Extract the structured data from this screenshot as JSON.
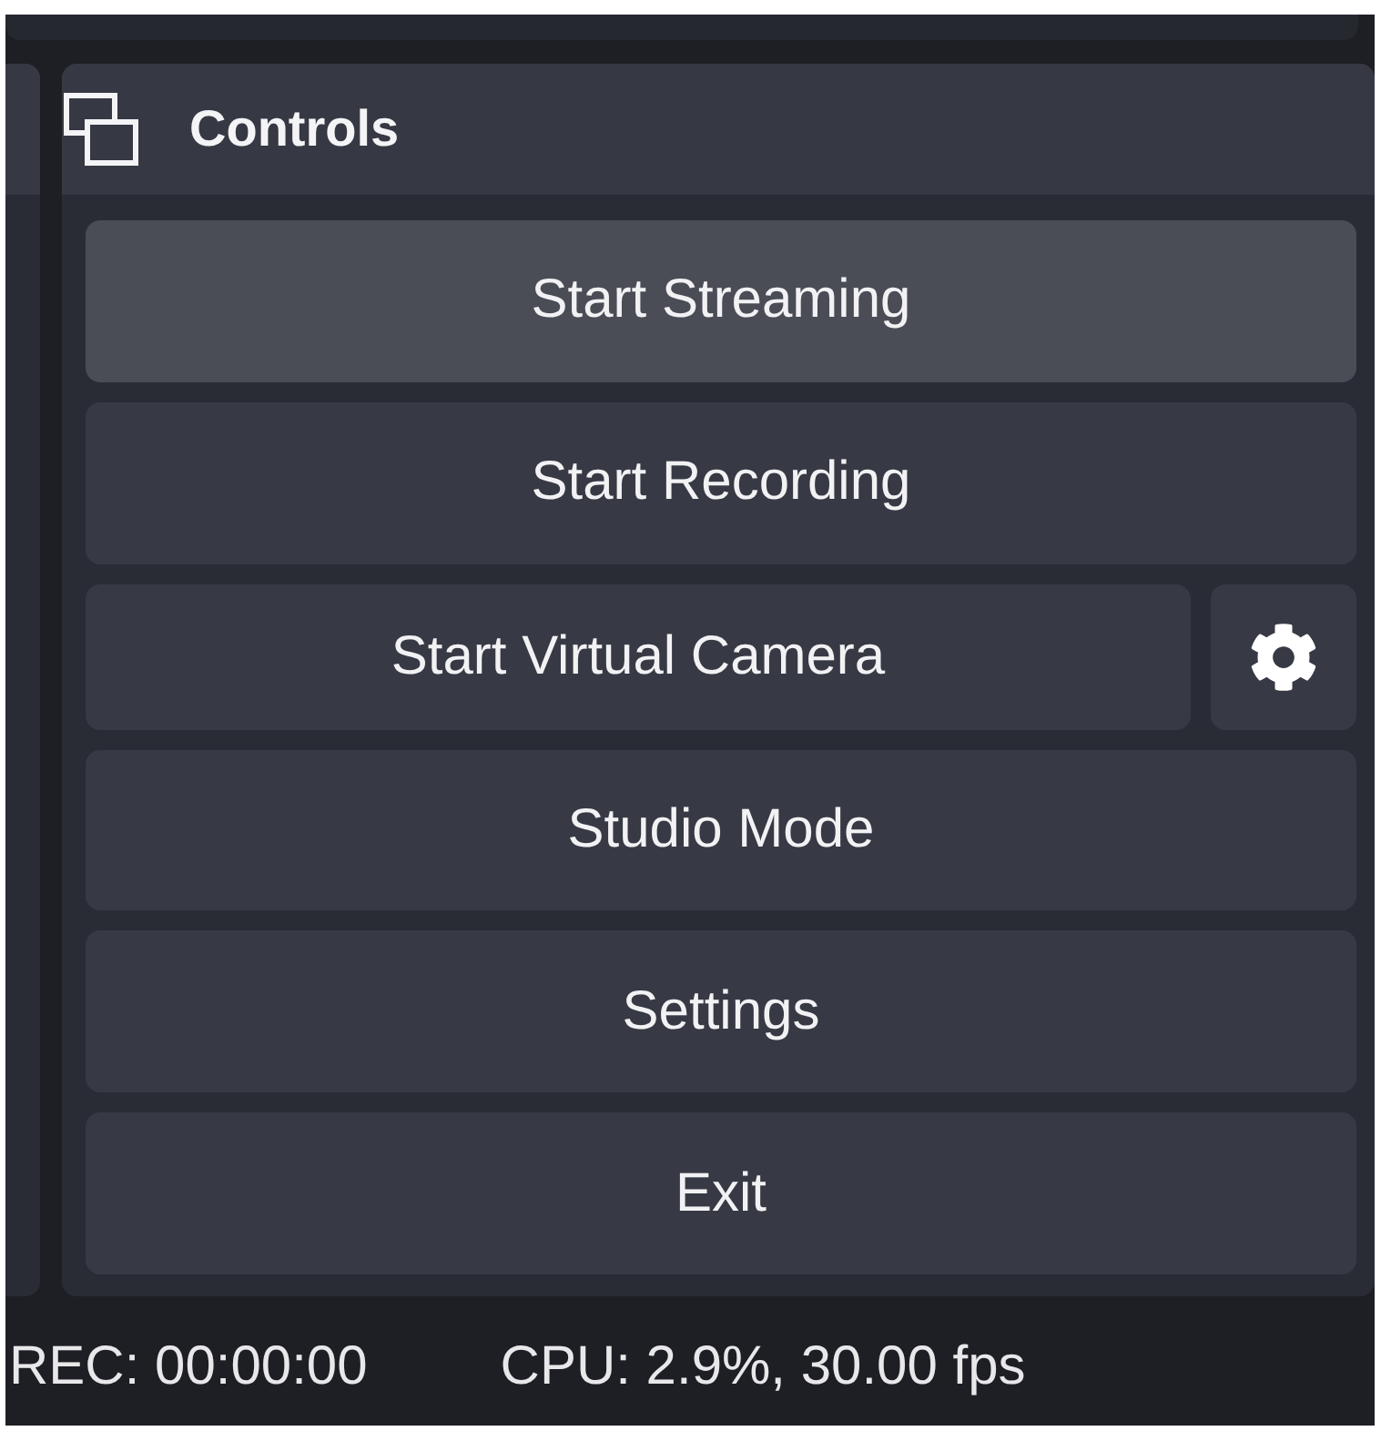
{
  "dock": {
    "title": "Controls"
  },
  "controls": [
    {
      "kind": "large",
      "label": "Start Streaming",
      "hovered": true
    },
    {
      "kind": "large",
      "label": "Start Recording",
      "hovered": false
    },
    {
      "kind": "split",
      "label": "Start Virtual Camera",
      "hovered": false
    },
    {
      "kind": "button",
      "label": "Studio Mode",
      "hovered": false
    },
    {
      "kind": "button",
      "label": "Settings",
      "hovered": false
    },
    {
      "kind": "button",
      "label": "Exit",
      "hovered": false
    }
  ],
  "status_bar": {
    "recording": "REC: 00:00:00",
    "performance": "CPU: 2.9%, 30.00 fps"
  }
}
